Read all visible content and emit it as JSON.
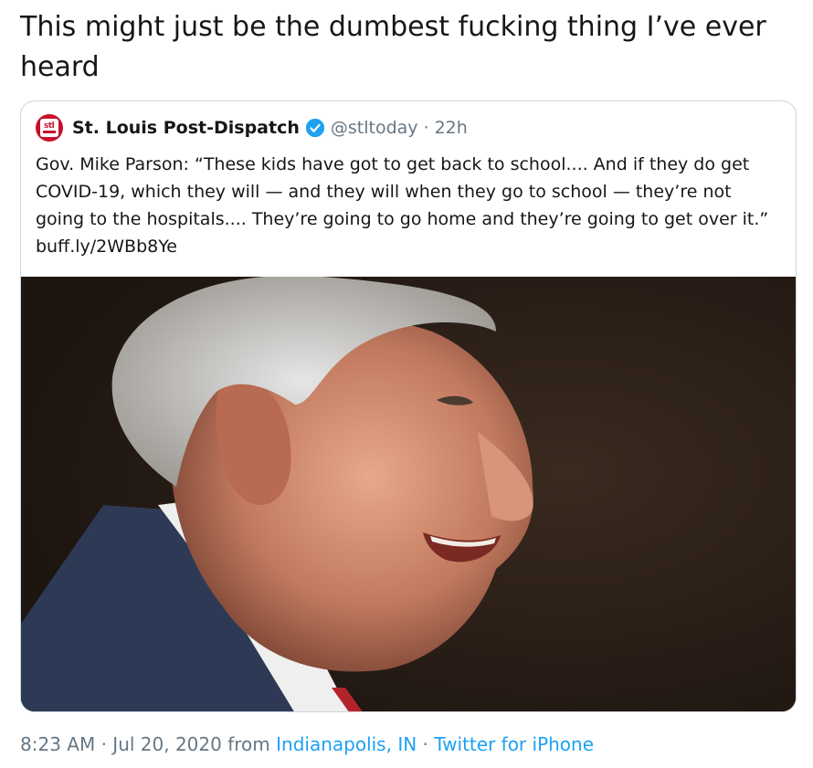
{
  "tweet": {
    "text": "This might just be the dumbest fucking thing I’ve ever heard"
  },
  "quoted": {
    "avatar_text": "stl",
    "display_name": "St. Louis Post-Dispatch",
    "handle": "@stltoday",
    "separator": "·",
    "time": "22h",
    "body": "Gov. Mike Parson: “These kids have got to get back to school.... And if they do get COVID-19, which they will — and they will when they go to school — they’re not going to the hospitals.... They’re going to go home and they’re going to get over it.”",
    "link": "buff.ly/2WBb8Ye",
    "media_icon": "photo"
  },
  "meta": {
    "time": "8:23 AM",
    "separator1": "·",
    "date": "Jul 20, 2020",
    "from_label": "from",
    "location": "Indianapolis, IN",
    "separator2": "·",
    "client": "Twitter for iPhone"
  },
  "colors": {
    "link": "#1da1f2",
    "muted": "#657786",
    "avatar": "#c8102e",
    "verified": "#1da1f2"
  }
}
